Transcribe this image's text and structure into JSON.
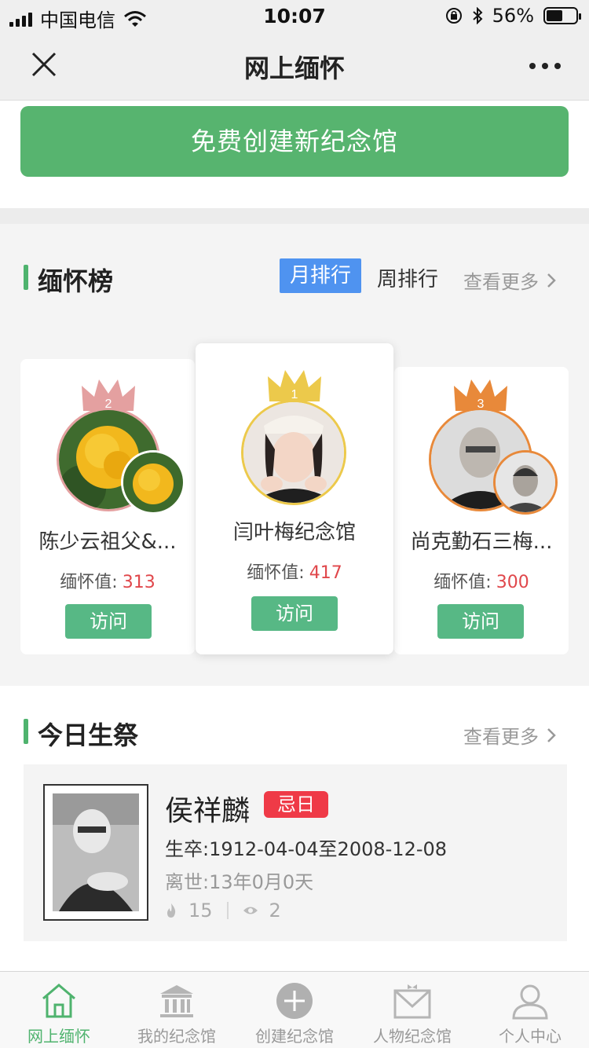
{
  "status": {
    "carrier": "中国电信",
    "time": "10:07",
    "battery": "56%"
  },
  "nav": {
    "title": "网上缅怀",
    "close_icon": "close-icon",
    "more_icon": "more-icon"
  },
  "create_button": "免费创建新纪念馆",
  "ranking": {
    "title": "缅怀榜",
    "tab_month": "月排行",
    "tab_week": "周排行",
    "more": "查看更多",
    "cards": [
      {
        "rank": "2",
        "name": "陈少云祖父&...",
        "value_label": "缅怀值:",
        "value": "313",
        "visit": "访问",
        "crown_color": "#e4a0a0"
      },
      {
        "rank": "1",
        "name": "闫叶梅纪念馆",
        "value_label": "缅怀值:",
        "value": "417",
        "visit": "访问",
        "crown_color": "#ecc94b"
      },
      {
        "rank": "3",
        "name": "尚克勤石三梅...",
        "value_label": "缅怀值:",
        "value": "300",
        "visit": "访问",
        "crown_color": "#e8893a"
      }
    ]
  },
  "today": {
    "title": "今日生祭",
    "more": "查看更多",
    "person": {
      "name": "侯祥麟",
      "tag": "忌日",
      "dates": "生卒:1912-04-04至2008-12-08",
      "passed": "离世:13年0月0天",
      "flowers": "15",
      "views": "2"
    }
  },
  "tabbar": [
    {
      "label": "网上缅怀",
      "icon": "home-icon",
      "active": true
    },
    {
      "label": "我的纪念馆",
      "icon": "memorial-hall-icon",
      "active": false
    },
    {
      "label": "创建纪念馆",
      "icon": "add-icon",
      "active": false
    },
    {
      "label": "人物纪念馆",
      "icon": "person-memorial-icon",
      "active": false
    },
    {
      "label": "个人中心",
      "icon": "user-icon",
      "active": false
    }
  ]
}
